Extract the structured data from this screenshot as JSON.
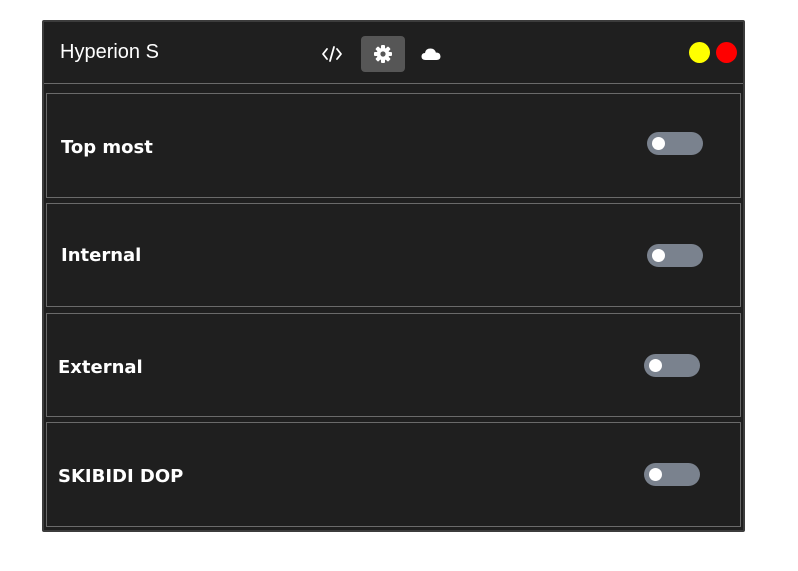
{
  "app": {
    "title": "Hyperion S"
  },
  "tabs": [
    {
      "name": "code",
      "icon": "code-icon",
      "active": false
    },
    {
      "name": "settings",
      "icon": "gear-icon",
      "active": true
    },
    {
      "name": "cloud",
      "icon": "cloud-icon",
      "active": false
    }
  ],
  "window_controls": {
    "minimize_color": "#ffff00",
    "close_color": "#ff0000"
  },
  "settings": [
    {
      "label": "Top most",
      "enabled": false
    },
    {
      "label": "Internal",
      "enabled": false
    },
    {
      "label": "External",
      "enabled": false
    },
    {
      "label": "SKIBIDI DOP",
      "enabled": false
    }
  ],
  "colors": {
    "background": "#1f1f1f",
    "toggle_off": "#7a828e",
    "active_tab": "#565656"
  }
}
